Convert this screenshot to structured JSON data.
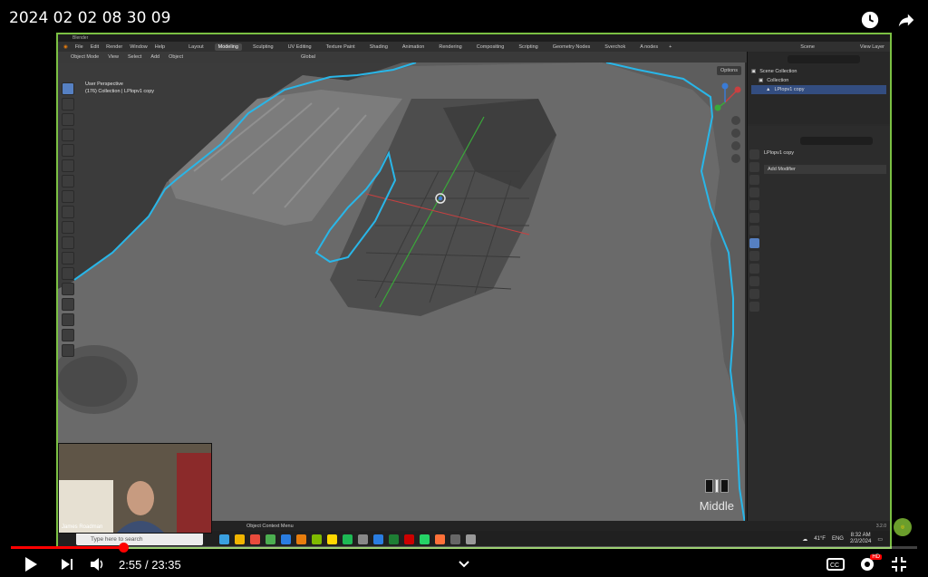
{
  "video": {
    "title": "2024 02 02 08 30 09",
    "time_current": "2:55",
    "time_separator": "/",
    "time_total": "23:35",
    "progress_fraction": 0.124,
    "hd_badge": "HD"
  },
  "blender": {
    "window_title": "Blender",
    "menu": [
      "File",
      "Edit",
      "Render",
      "Window",
      "Help"
    ],
    "workspaces": [
      "Layout",
      "Modeling",
      "Sculpting",
      "UV Editing",
      "Texture Paint",
      "Shading",
      "Animation",
      "Rendering",
      "Compositing",
      "Scripting",
      "Geometry Nodes",
      "Sverchok",
      "A nodes"
    ],
    "active_workspace": "Modeling",
    "scene_label": "Scene",
    "view_layer_label": "View Layer",
    "header": {
      "mode": "Object Mode",
      "menus": [
        "View",
        "Select",
        "Add",
        "Object"
      ],
      "orientation": "Global",
      "options": "Options"
    },
    "viewport_info": {
      "line1": "User Perspective",
      "line2": "(176) Collection | LPlopv1 copy"
    },
    "mouse_button_label": "Middle",
    "outliner": {
      "scene_collection": "Scene Collection",
      "collection": "Collection",
      "object": "LPlopv1 copy"
    },
    "properties": {
      "object_name": "LPlopv1 copy",
      "add_modifier": "Add Modifier"
    },
    "status_bar": {
      "context_menu": "Object Context Menu",
      "version": "3.2.0"
    }
  },
  "webcam": {
    "name": "James Roadman"
  },
  "taskbar": {
    "search_placeholder": "Type here to search",
    "weather": "41°F",
    "language": "ENG",
    "clock_time": "8:32 AM",
    "clock_date": "2/2/2024"
  },
  "colors": {
    "outline": "#29b6e8",
    "progress": "#ff0000",
    "frame": "#7bc043"
  }
}
